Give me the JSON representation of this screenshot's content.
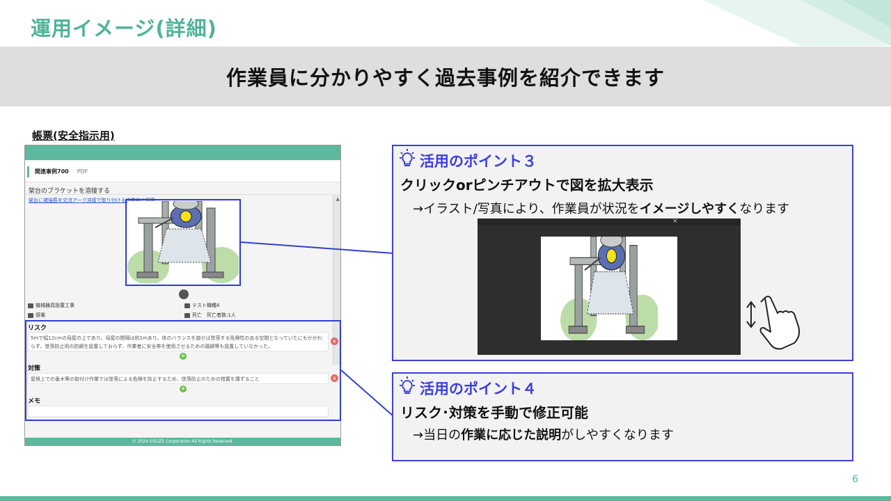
{
  "slide": {
    "title": "運用イメージ(詳細)",
    "banner": "作業員に分かりやすく過去事例を紹介できます",
    "page_number": "6",
    "accent_color": "#4fb39a",
    "callout_color": "#3d3fd8"
  },
  "form": {
    "caption": "帳票(安全指示用)",
    "tab_active": "関連事例700",
    "tab_pdf": "PDF",
    "case_title": "架台のブラケットを溶接する",
    "case_link": "架台に補強筋を交流アーク溶接で取り付ける作業中に感電",
    "meta": {
      "industry": "機械器具設置工事",
      "accident_type": "感電",
      "user": "テスト職種4",
      "casualty": "死亡　死亡者数:1人"
    },
    "risk_label": "リスク",
    "risk_text": "5mで幅12cmの母屋の上であり、母屋の間隔は約1mあり、体のバランスを崩せば墜落する危険性のある空間となっていたにもかかわらず、墜落防止用の防網を設置しておらず、作業者に安全帯を使用させるための親綱等も設置していなかった。",
    "measure_label": "対策",
    "measure_text": "屋根上での垂木等の取付け作業では墜落による危険を防止するため、墜落防止のための措置を講ずること",
    "memo_label": "メモ",
    "footer": "© 2024 SOLIZE Corporation All Rights Reserved."
  },
  "point3": {
    "title": "活用のポイント３",
    "heading": "クリックorピンチアウトで図を拡大表示",
    "desc_prefix": "→イラスト/写真により、作業員が状況を",
    "desc_bold": "イメージしやすく",
    "desc_suffix": "なります"
  },
  "point4": {
    "title": "活用のポイント４",
    "heading": "リスク･対策を手動で修正可能",
    "desc_prefix": "→当日の",
    "desc_bold1": "作業に応じた",
    "desc_bold2": "説明",
    "desc_suffix": "がしやすくなります"
  },
  "icons": [
    "lightbulb-icon",
    "pinch-zoom-icon",
    "close-icon",
    "delete-icon",
    "add-icon"
  ]
}
